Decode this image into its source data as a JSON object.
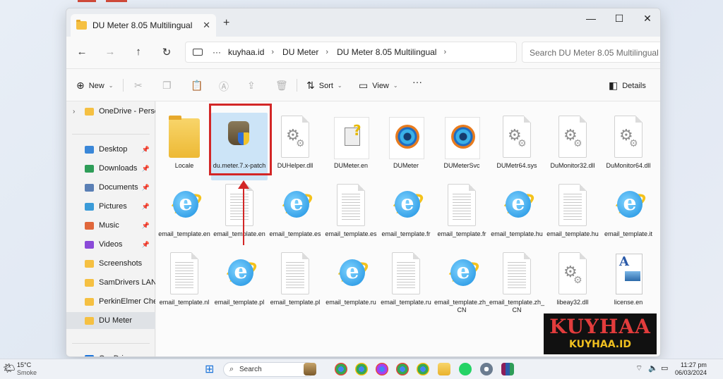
{
  "window": {
    "tab_title": "DU Meter 8.05 Multilingual",
    "tab_close": "✕",
    "new_tab": "+",
    "minimize": "—",
    "maximize": "☐",
    "close": "✕"
  },
  "nav": {
    "back": "←",
    "forward": "→",
    "up": "↑",
    "refresh": "↻",
    "more": "···",
    "breadcrumb": [
      "kuyhaa.id",
      "DU Meter",
      "DU Meter 8.05 Multilingual"
    ],
    "separator": "›",
    "search_placeholder": "Search DU Meter 8.05 Multilingual"
  },
  "toolbar": {
    "new_label": "New",
    "sort_label": "Sort",
    "view_label": "View",
    "more_label": "···",
    "details_label": "Details"
  },
  "sidebar": {
    "items": [
      {
        "label": "OneDrive - Perso",
        "icon": "folder-icon",
        "color": "#f5c042",
        "chevron": "›"
      },
      {
        "label": "Desktop",
        "icon": "desktop-icon",
        "color": "#3a87d8",
        "pinned": true
      },
      {
        "label": "Downloads",
        "icon": "download-icon",
        "color": "#2e9d58",
        "pinned": true
      },
      {
        "label": "Documents",
        "icon": "documents-icon",
        "color": "#5a7fb5",
        "pinned": true
      },
      {
        "label": "Pictures",
        "icon": "pictures-icon",
        "color": "#3a9bd8",
        "pinned": true
      },
      {
        "label": "Music",
        "icon": "music-icon",
        "color": "#e0673b",
        "pinned": true
      },
      {
        "label": "Videos",
        "icon": "videos-icon",
        "color": "#8a4ad8",
        "pinned": true
      },
      {
        "label": "Screenshots",
        "icon": "folder-icon",
        "color": "#f5c042"
      },
      {
        "label": "SamDrivers LAN",
        "icon": "folder-icon",
        "color": "#f5c042"
      },
      {
        "label": "PerkinElmer Che",
        "icon": "folder-icon",
        "color": "#f5c042"
      },
      {
        "label": "DU Meter",
        "icon": "folder-icon",
        "color": "#f5c042",
        "selected": true
      },
      {
        "label": "OneDrive",
        "icon": "cloud-icon",
        "color": "#1a73d9",
        "chevron": "›"
      }
    ],
    "pin_glyph": "📌"
  },
  "files": [
    {
      "name": "Locale",
      "icon": "folder"
    },
    {
      "name": "du.meter.7.x-patch",
      "icon": "patch",
      "selected": true
    },
    {
      "name": "DUHelper.dll",
      "icon": "gear-doc"
    },
    {
      "name": "DUMeter.en",
      "icon": "help"
    },
    {
      "name": "DUMeter",
      "icon": "dumeter"
    },
    {
      "name": "DUMeterSvc",
      "icon": "dumeter"
    },
    {
      "name": "DUMetr64.sys",
      "icon": "gear-doc"
    },
    {
      "name": "DuMonitor32.dll",
      "icon": "gear-doc"
    },
    {
      "name": "DuMonitor64.dll",
      "icon": "gear-doc"
    },
    {
      "name": "email_template.en",
      "icon": "ie"
    },
    {
      "name": "email_template.en",
      "icon": "text-doc"
    },
    {
      "name": "email_template.es",
      "icon": "ie"
    },
    {
      "name": "email_template.es",
      "icon": "text-doc"
    },
    {
      "name": "email_template.fr",
      "icon": "ie"
    },
    {
      "name": "email_template.fr",
      "icon": "text-doc"
    },
    {
      "name": "email_template.hu",
      "icon": "ie"
    },
    {
      "name": "email_template.hu",
      "icon": "text-doc"
    },
    {
      "name": "email_template.it",
      "icon": "ie"
    },
    {
      "name": "email_template.nl",
      "icon": "text-doc"
    },
    {
      "name": "email_template.pl",
      "icon": "ie"
    },
    {
      "name": "email_template.pl",
      "icon": "text-doc"
    },
    {
      "name": "email_template.ru",
      "icon": "ie"
    },
    {
      "name": "email_template.ru",
      "icon": "text-doc"
    },
    {
      "name": "email_template.zh_CN",
      "icon": "ie"
    },
    {
      "name": "email_template.zh_CN",
      "icon": "text-doc"
    },
    {
      "name": "libeay32.dll",
      "icon": "gear-doc"
    },
    {
      "name": "license.en",
      "icon": "license"
    }
  ],
  "taskbar": {
    "weather_temp": "15°C",
    "weather_desc": "Smoke",
    "search_label": "Search",
    "time": "11:27 pm",
    "date": "06/03/2024"
  },
  "watermark": {
    "line1": "KUYHAA",
    "line2": "KUYHAA.ID"
  },
  "colors": {
    "accent": "#0067c0",
    "highlight": "#d32626",
    "selection": "#cce4f7"
  }
}
